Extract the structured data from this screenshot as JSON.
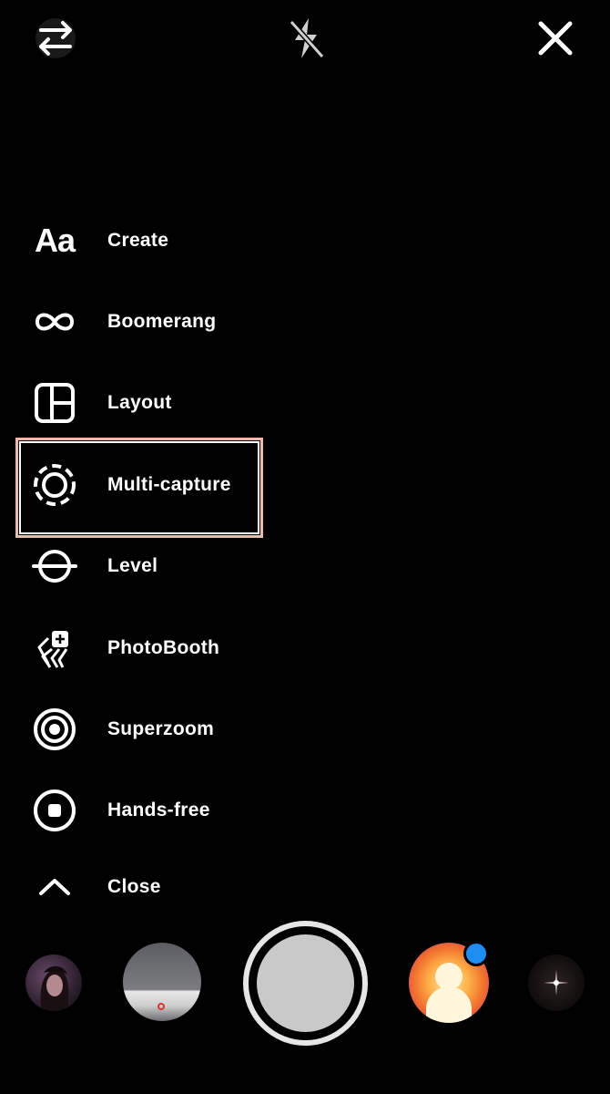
{
  "top_bar": {
    "flip_icon": "flip-camera-icon",
    "flash_icon": "flash-off-icon",
    "close_icon": "close-icon"
  },
  "menu": {
    "items": [
      {
        "label": "Create",
        "icon": "text-aa-icon",
        "icon_text": "Aa"
      },
      {
        "label": "Boomerang",
        "icon": "infinity-icon"
      },
      {
        "label": "Layout",
        "icon": "layout-grid-icon"
      },
      {
        "label": "Multi-capture",
        "icon": "dashed-circle-icon",
        "highlighted": true
      },
      {
        "label": "Level",
        "icon": "level-icon"
      },
      {
        "label": "PhotoBooth",
        "icon": "photobooth-stack-icon"
      },
      {
        "label": "Superzoom",
        "icon": "target-icon"
      },
      {
        "label": "Hands-free",
        "icon": "record-stop-icon"
      },
      {
        "label": "Close",
        "icon": "chevron-up-icon"
      }
    ]
  },
  "bottom_bar": {
    "highlight_color": "#f3b7ad",
    "badge_color": "#1e8ff0"
  }
}
